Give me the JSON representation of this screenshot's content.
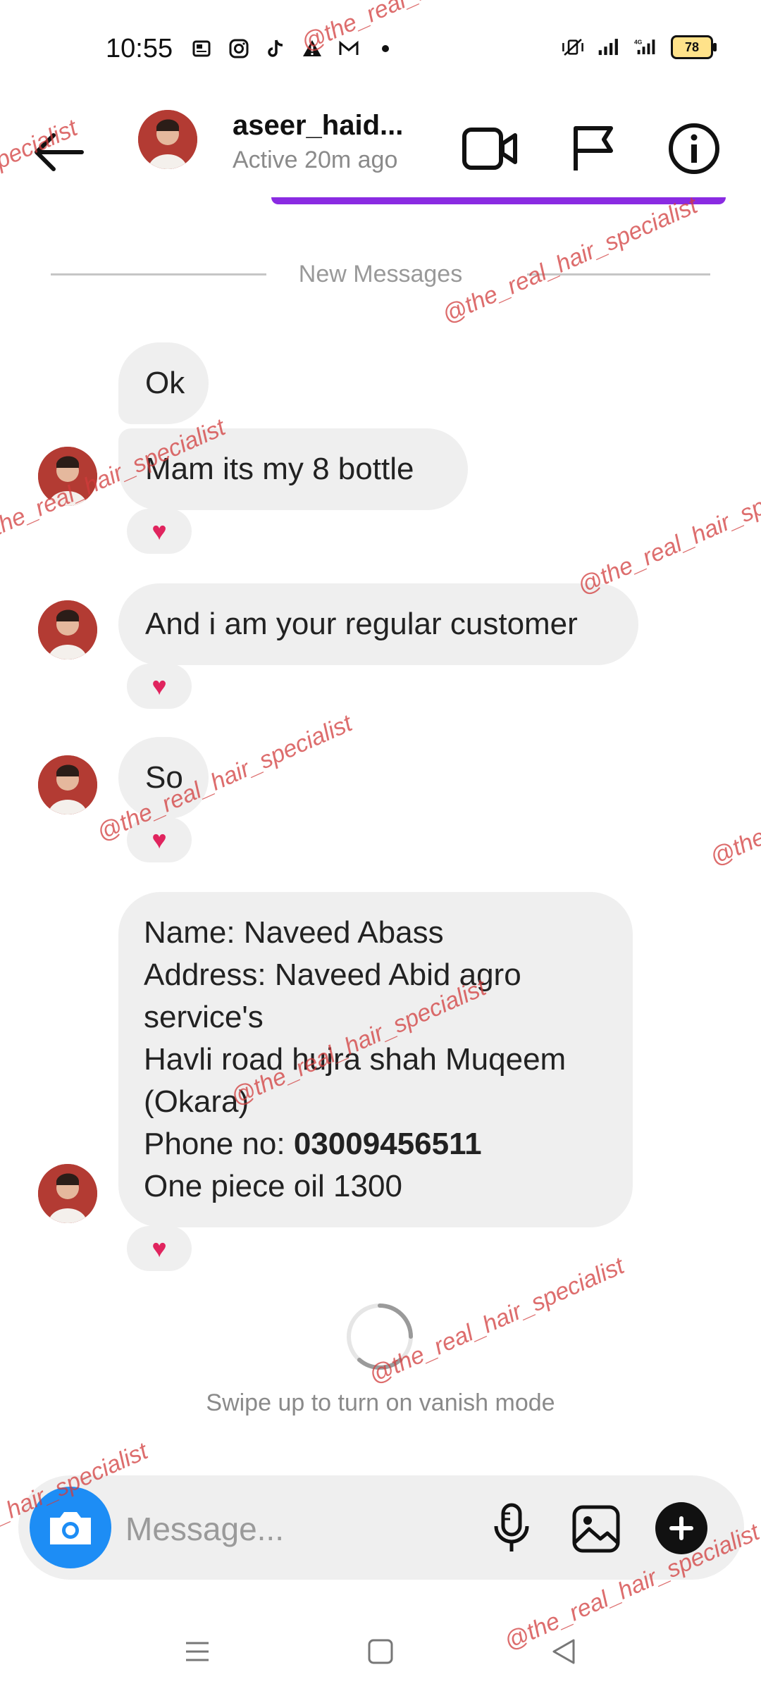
{
  "status_bar": {
    "time": "10:55",
    "battery": "78",
    "network": "4G"
  },
  "header": {
    "username": "aseer_haid...",
    "status": "Active 20m ago"
  },
  "divider": {
    "label": "New Messages"
  },
  "messages": [
    {
      "text": "Ok",
      "reaction": "❤️"
    },
    {
      "text": "Mam its my 8 bottle",
      "reaction": "❤️"
    },
    {
      "text": "And i am your regular customer",
      "reaction": "❤️"
    },
    {
      "text": "So",
      "reaction": "❤️"
    },
    {
      "lines": [
        "Name: Naveed Abass",
        "Address: Naveed Abid agro",
        "service's",
        "Havli road hujra shah Muqeem",
        "(Okara)"
      ],
      "phone_label": "Phone no: ",
      "phone_number": "03009456511",
      "last_line": "One piece oil 1300",
      "reaction": "❤️"
    }
  ],
  "vanish_text": "Swipe up to turn on vanish mode",
  "composer": {
    "placeholder": "Message..."
  },
  "watermark": "@the_real_hair_specialist",
  "colors": {
    "accent": "#1d8df5",
    "purple": "#8a2be2",
    "bubble": "#efefef"
  }
}
